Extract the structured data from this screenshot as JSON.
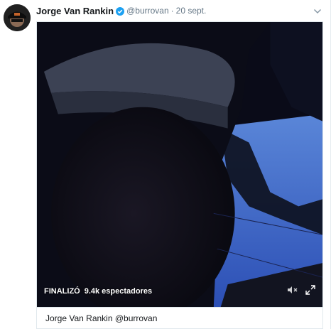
{
  "tweet": {
    "author_name": "Jorge Van Rankin",
    "handle": "@burrovan",
    "separator": "·",
    "date": "20 sept."
  },
  "broadcast": {
    "status": "FINALIZÓ",
    "viewers": "9.4k espectadores"
  },
  "card": {
    "title": "Jorge Van Rankin @burrovan"
  },
  "colors": {
    "verified": "#1da1f2",
    "name": "#14171a",
    "secondary": "#657786",
    "border": "#e1e8ed"
  },
  "icons": [
    "verified-badge-icon",
    "chevron-down-icon",
    "speaker-muted-icon",
    "fullscreen-icon"
  ]
}
